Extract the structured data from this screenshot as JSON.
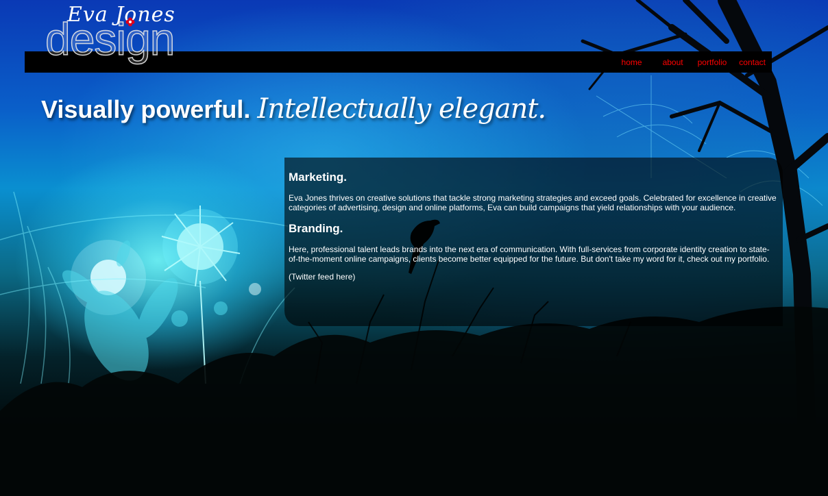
{
  "logo": {
    "script_text": "Eva Jones",
    "word_text": "design",
    "flower_color": "#e0001b"
  },
  "nav": {
    "items": [
      {
        "label": "home"
      },
      {
        "label": "about"
      },
      {
        "label": "portfolio"
      },
      {
        "label": "contact"
      }
    ],
    "link_color": "#ff0000"
  },
  "hero": {
    "bold_text": "Visually powerful.",
    "script_text": "Intellectually elegant."
  },
  "content": {
    "marketing": {
      "heading": "Marketing.",
      "body": "Eva Jones thrives on creative solutions that tackle strong marketing strategies and exceed goals. Celebrated for excellence in creative categories of advertising, design and online platforms, Eva can build campaigns that yield relationships with your audience."
    },
    "branding": {
      "heading": "Branding.",
      "body": "Here, professional talent leads brands into the next era of communication. With full-services from corporate identity creation to state-of-the-moment online campaigns, clients become better equipped for the future. But don't take my word for it, check out my portfolio."
    },
    "twitter_placeholder": "(Twitter feed here)"
  },
  "theme": {
    "sky_top": "#0a39b5",
    "glow": "#78ffff",
    "panel_bg": "rgba(0,0,0,0.6)"
  }
}
